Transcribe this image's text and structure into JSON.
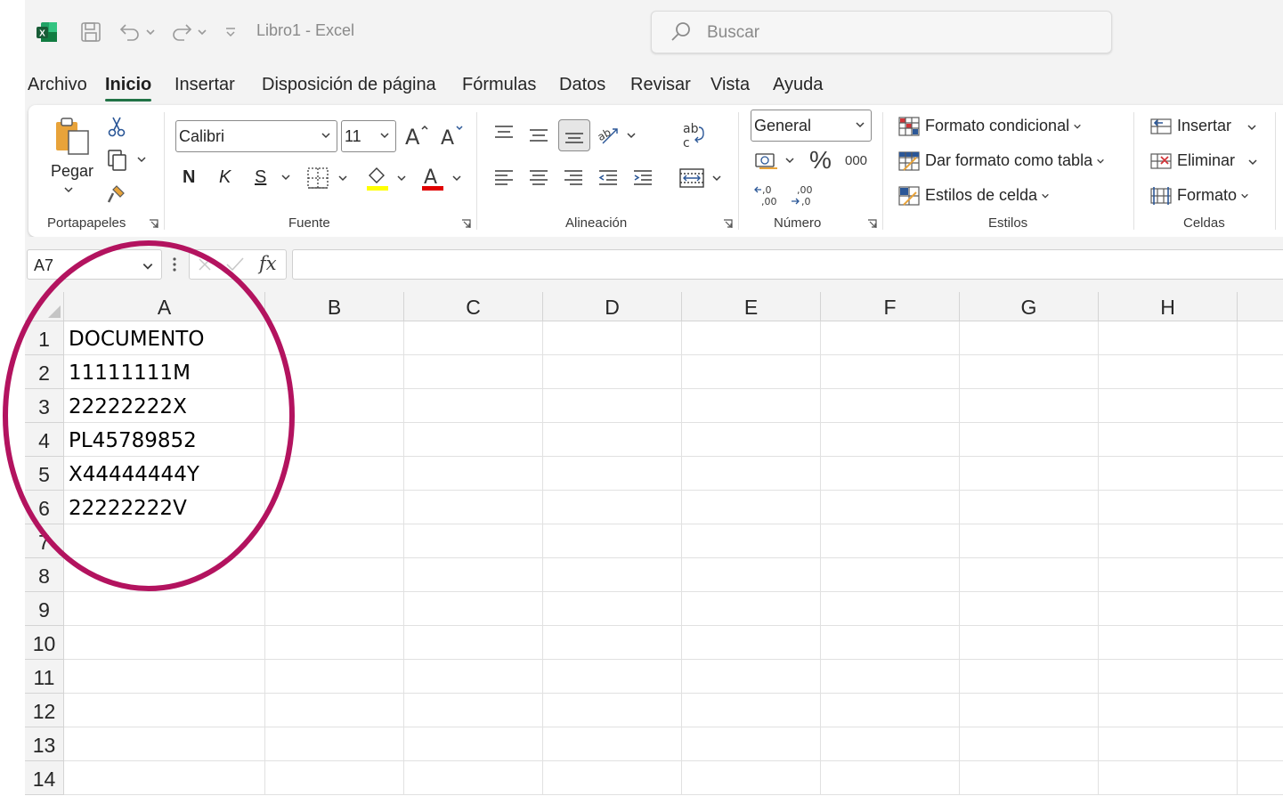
{
  "app": {
    "title": "Libro1  -  Excel",
    "search_placeholder": "Buscar"
  },
  "menu": {
    "tabs": [
      "Archivo",
      "Inicio",
      "Insertar",
      "Disposición de página",
      "Fórmulas",
      "Datos",
      "Revisar",
      "Vista",
      "Ayuda"
    ],
    "active": "Inicio"
  },
  "ribbon": {
    "clipboard": {
      "paste_label": "Pegar",
      "group_label": "Portapapeles"
    },
    "font": {
      "family": "Calibri",
      "size": "11",
      "bold": "N",
      "italic": "K",
      "underline": "S",
      "group_label": "Fuente"
    },
    "alignment": {
      "group_label": "Alineación"
    },
    "number": {
      "format": "General",
      "thousands": "000",
      "group_label": "Número"
    },
    "styles": {
      "conditional": "Formato condicional",
      "as_table": "Dar formato como tabla",
      "cell_styles": "Estilos de celda",
      "group_label": "Estilos"
    },
    "cells": {
      "insert": "Insertar",
      "delete": "Eliminar",
      "format": "Formato",
      "group_label": "Celdas"
    }
  },
  "formula_bar": {
    "name_box": "A7",
    "fx": "fx",
    "value": ""
  },
  "sheet": {
    "columns": [
      "A",
      "B",
      "C",
      "D",
      "E",
      "F",
      "G",
      "H"
    ],
    "rows": [
      "1",
      "2",
      "3",
      "4",
      "5",
      "6",
      "7",
      "8",
      "9",
      "10",
      "11",
      "12",
      "13",
      "14"
    ],
    "column_a": [
      "DOCUMENTO",
      "11111111M",
      "22222222X",
      "PL45789852",
      "X44444444Y",
      "22222222V"
    ],
    "selected_cell": "A7"
  },
  "colors": {
    "excel_green": "#217346",
    "annotation_circle": "#b3135f",
    "font_color_bar": "#e00000",
    "fill_color_bar": "#ffff00"
  }
}
